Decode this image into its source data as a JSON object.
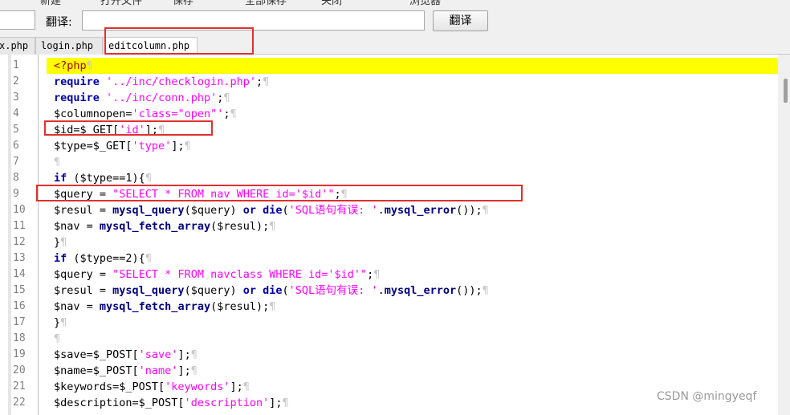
{
  "toolbar": {
    "items": [
      "新建",
      "打开文件",
      "保存",
      "全部保存",
      "关闭",
      "浏览器"
    ]
  },
  "translate": {
    "label": "翻译:",
    "input_value": "",
    "button_label": "翻译"
  },
  "tabs": [
    {
      "label": "x.php"
    },
    {
      "label": "login.php"
    },
    {
      "label": "editcolumn.php"
    }
  ],
  "editor": {
    "line_numbers": [
      "1",
      "2",
      "3",
      "4",
      "5",
      "6",
      "7",
      "8",
      "9",
      "10",
      "11",
      "12",
      "13",
      "14",
      "15",
      "16",
      "17",
      "18",
      "19",
      "20",
      "21",
      "22"
    ],
    "lines": [
      "<?php",
      "require '../inc/checklogin.php';",
      "require '../inc/conn.php';",
      "$columnopen='class=\"open\"';",
      "$id=$_GET['id'];",
      "$type=$_GET['type'];",
      "",
      "if ($type==1){",
      "$query = \"SELECT * FROM nav WHERE id='$id'\";",
      "$resul = mysql_query($query) or die('SQL语句有误: '.mysql_error());",
      "$nav = mysql_fetch_array($resul);",
      "}",
      "if ($type==2){",
      "$query = \"SELECT * FROM navclass WHERE id='$id'\";",
      "$resul = mysql_query($query) or die('SQL语句有误: '.mysql_error());",
      "$nav = mysql_fetch_array($resul);",
      "}",
      "",
      "$save=$_POST['save'];",
      "$name=$_POST['name'];",
      "$keywords=$_POST['keywords'];",
      "$description=$_POST['description'];"
    ],
    "pilcrow": "¶"
  },
  "watermark": "CSDN @mingyeqf",
  "colors": {
    "highlight_box": "#e03030",
    "current_line": "#ffff00",
    "keyword": "#0000aa",
    "string": "#ff00ff"
  }
}
